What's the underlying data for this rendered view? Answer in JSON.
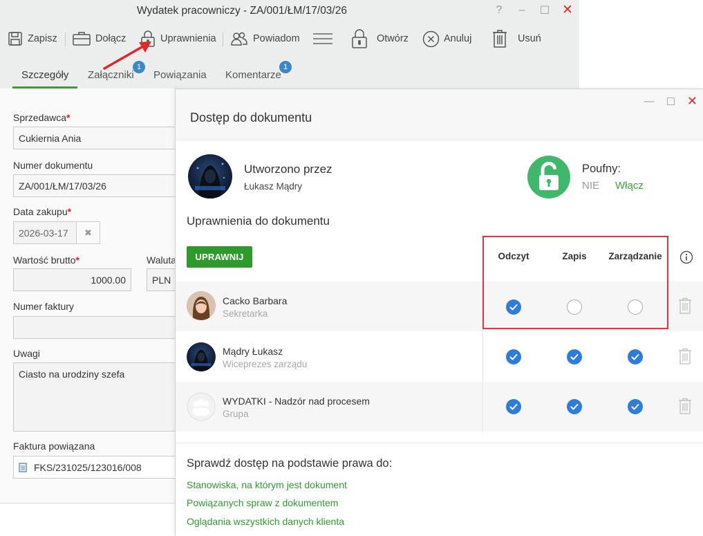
{
  "window": {
    "title": "Wydatek pracowniczy - ZA/001/ŁM/17/03/26",
    "help": "?"
  },
  "toolbar": {
    "save": "Zapisz",
    "attach": "Dołącz",
    "permissions": "Uprawnienia",
    "notify": "Powiadom",
    "open": "Otwórz",
    "cancel": "Anuluj",
    "delete": "Usuń"
  },
  "tabs": {
    "details": "Szczegóły",
    "attachments": "Załączniki",
    "attachments_badge": "1",
    "links": "Powiązania",
    "comments": "Komentarze",
    "comments_badge": "1"
  },
  "form": {
    "seller_label": "Sprzedawca",
    "seller_value": "Cukiernia Ania",
    "docnum_label": "Numer dokumentu",
    "docnum_value": "ZA/001/ŁM/17/03/26",
    "date_label": "Data zakupu",
    "date_value": "2026-03-17",
    "gross_label": "Wartość brutto",
    "gross_value": "1000.00",
    "currency_label": "Waluta",
    "currency_value": "PLN",
    "invoice_label": "Numer faktury",
    "invoice_value": "",
    "notes_label": "Uwagi",
    "notes_value": "Ciasto na urodziny szefa",
    "linked_label": "Faktura powiązana",
    "linked_value": "FKS/231025/123016/008",
    "required_mark": "*"
  },
  "modal": {
    "title": "Dostęp do dokumentu",
    "created_by_label": "Utworzono przez",
    "created_by_name": "Łukasz Mądry",
    "confidential_label": "Poufny:",
    "confidential_value": "NIE",
    "enable_link": "Włącz",
    "permissions_title": "Uprawnienia do dokumentu",
    "grant_button": "UPRAWNIJ",
    "columns": {
      "read": "Odczyt",
      "write": "Zapis",
      "manage": "Zarządzanie"
    },
    "rows": [
      {
        "name": "Cacko Barbara",
        "role": "Sekretarka",
        "read": true,
        "write": false,
        "manage": false
      },
      {
        "name": "Mądry Łukasz",
        "role": "Wiceprezes zarządu",
        "read": true,
        "write": true,
        "manage": true
      },
      {
        "name": "WYDATKI - Nadzór nad procesem",
        "role": "Grupa",
        "read": true,
        "write": true,
        "manage": true
      }
    ],
    "check_title": "Sprawdź dostęp na podstawie prawa do:",
    "links": [
      "Stanowiska, na którym jest dokument",
      "Powiązanych spraw z dokumentem",
      "Oglądania wszystkich danych klienta"
    ]
  },
  "colors": {
    "accent_green": "#2e9a2e",
    "check_blue": "#2e7dd6",
    "highlight_red": "#e0363c",
    "lock_green": "#3fb86b",
    "badge_blue": "#3a88c8"
  }
}
